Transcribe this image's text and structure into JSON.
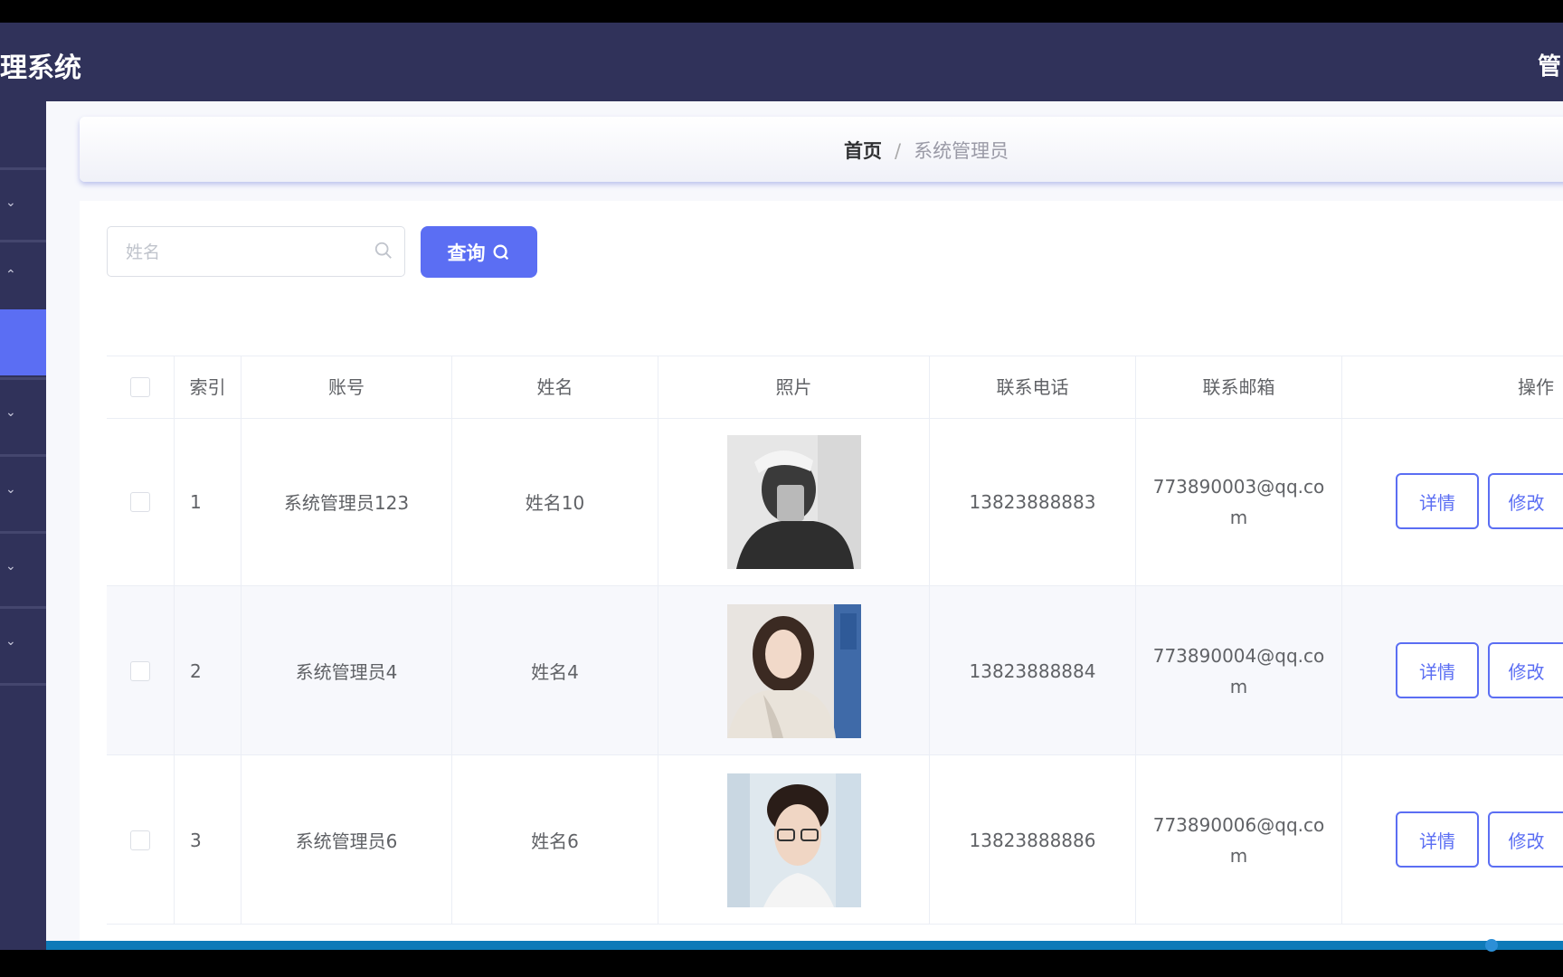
{
  "header": {
    "title": "理系统",
    "user": "管"
  },
  "breadcrumb": {
    "home": "首页",
    "separator": "/",
    "current": "系统管理员"
  },
  "search": {
    "placeholder": "姓名",
    "button_label": "查询"
  },
  "table": {
    "columns": [
      "索引",
      "账号",
      "姓名",
      "照片",
      "联系电话",
      "联系邮箱",
      "操作"
    ],
    "rows": [
      {
        "index": "1",
        "account": "系统管理员123",
        "name": "姓名10",
        "phone": "13823888883",
        "email": "773890003@qq.com"
      },
      {
        "index": "2",
        "account": "系统管理员4",
        "name": "姓名4",
        "phone": "13823888884",
        "email": "773890004@qq.com"
      },
      {
        "index": "3",
        "account": "系统管理员6",
        "name": "姓名6",
        "phone": "13823888886",
        "email": "773890006@qq.com"
      }
    ],
    "actions": {
      "detail": "详情",
      "edit": "修改"
    }
  },
  "colors": {
    "header_bg": "#30325a",
    "accent": "#5b6ef3"
  }
}
